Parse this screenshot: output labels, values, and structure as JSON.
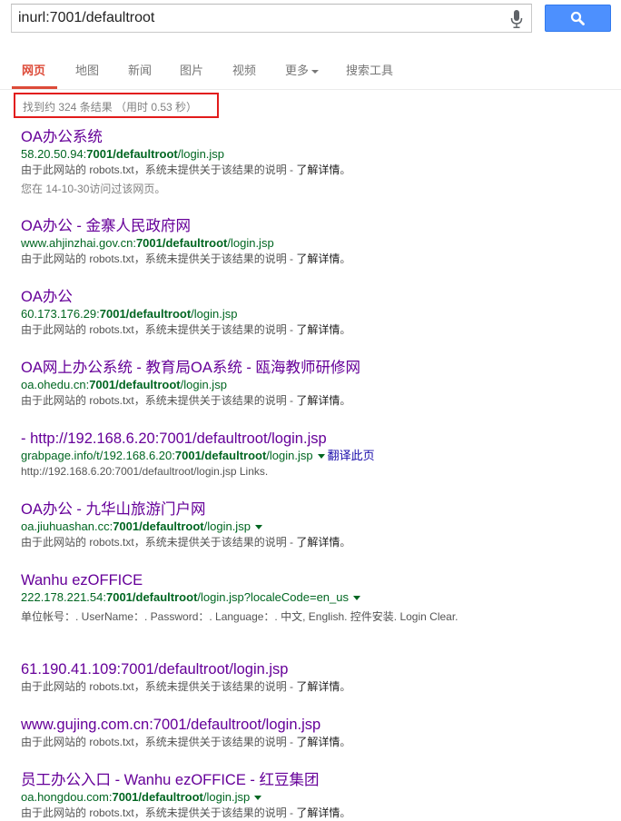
{
  "search": {
    "query": "inurl:7001/defaultroot"
  },
  "tabs": [
    {
      "label": "网页",
      "active": true
    },
    {
      "label": "地图"
    },
    {
      "label": "新闻"
    },
    {
      "label": "图片"
    },
    {
      "label": "视频"
    },
    {
      "label": "更多"
    },
    {
      "label": "搜索工具"
    }
  ],
  "stats": "找到约 324 条结果 （用时 0.53 秒）",
  "common": {
    "robots_snippet": "由于此网站的 robots.txt，系统未提供关于该结果的说明 - ",
    "learn_more": "了解详情",
    "period": "。",
    "translate": "翻译此页"
  },
  "results": [
    {
      "title": "OA办公系统",
      "url_pre": "58.20.50.94:",
      "url_bold": "7001/defaultroot",
      "url_post": "/login.jsp",
      "visited": "您在 14-10-30访问过该网页。"
    },
    {
      "title": "OA办公 - 金寨人民政府网",
      "url_pre": "www.ahjinzhai.gov.cn:",
      "url_bold": "7001/defaultroot",
      "url_post": "/login.jsp"
    },
    {
      "title": "OA办公",
      "url_pre": "60.173.176.29:",
      "url_bold": "7001/defaultroot",
      "url_post": "/login.jsp"
    },
    {
      "title": "OA网上办公系统 - 教育局OA系统 - 瓯海教师研修网",
      "url_pre": "oa.ohedu.cn:",
      "url_bold": "7001/defaultroot",
      "url_post": "/login.jsp"
    },
    {
      "title": "- http://192.168.6.20:7001/defaultroot/login.jsp",
      "url_pre": "grabpage.info/t/192.168.6.20:",
      "url_bold": "7001/defaultroot",
      "url_post": "/login.jsp",
      "snippet": "http://192.168.6.20:7001/defaultroot/login.jsp Links."
    },
    {
      "title": "OA办公 - 九华山旅游门户网",
      "url_pre": "oa.jiuhuashan.cc:",
      "url_bold": "7001/defaultroot",
      "url_post": "/login.jsp"
    },
    {
      "title": "Wanhu ezOFFICE",
      "url_pre": "222.178.221.54:",
      "url_bold": "7001/defaultroot",
      "url_post": "/login.jsp?localeCode=en_us",
      "snippet": "单位帐号：. UserName：. Password：. Language：. 中文, English. 控件安装. Login Clear."
    },
    {
      "title": "61.190.41.109:7001/defaultroot/login.jsp"
    },
    {
      "title": "www.gujing.com.cn:7001/defaultroot/login.jsp"
    },
    {
      "title": "员工办公入口 - Wanhu ezOFFICE - 红豆集团",
      "url_pre": "oa.hongdou.com:",
      "url_bold": "7001/defaultroot",
      "url_post": "/login.jsp"
    }
  ]
}
